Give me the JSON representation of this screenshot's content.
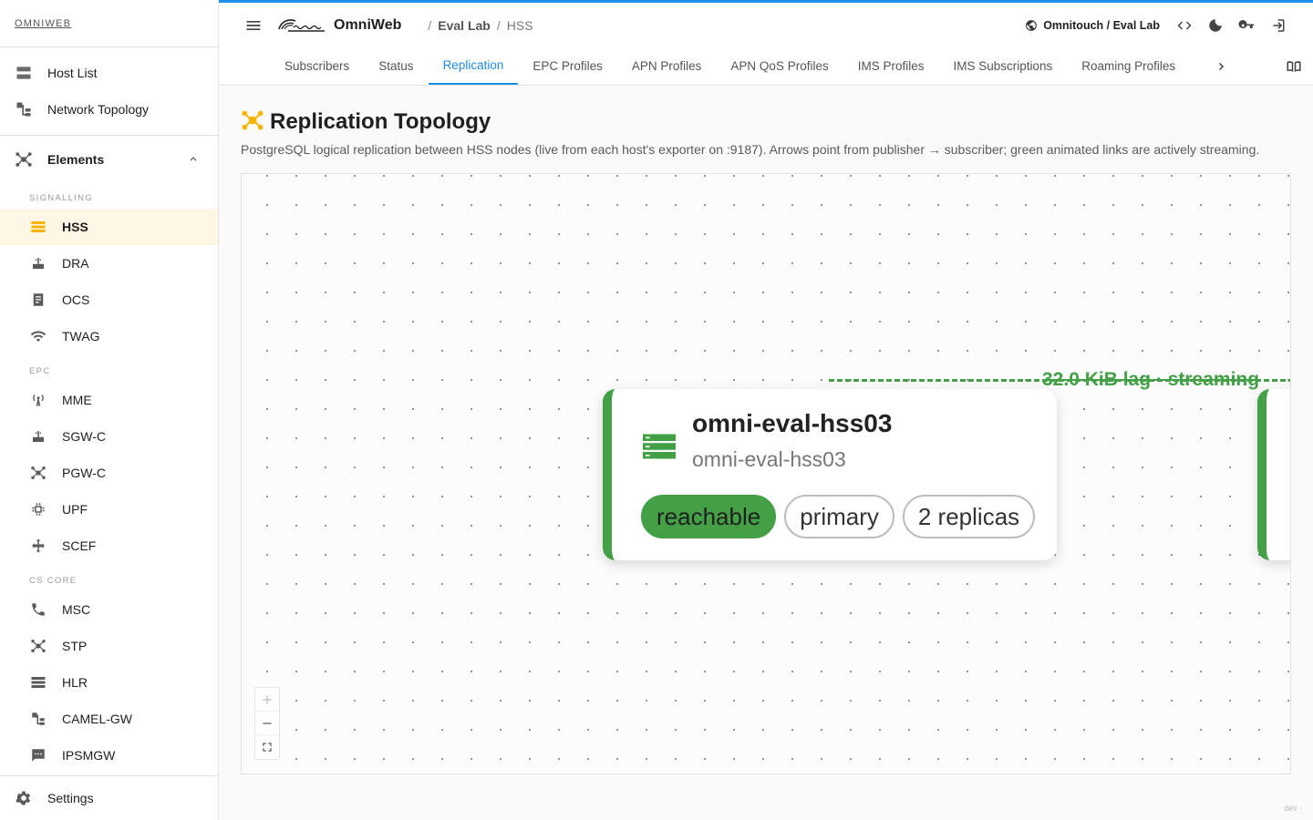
{
  "brand": "OMNIWEB",
  "nav": {
    "top_items": [
      {
        "label": "Host List",
        "icon": "host-list-icon"
      },
      {
        "label": "Network Topology",
        "icon": "network-topology-icon"
      }
    ],
    "elements_label": "Elements",
    "sections": [
      {
        "label": "SIGNALLING",
        "items": [
          {
            "label": "HSS",
            "active": true
          },
          {
            "label": "DRA"
          },
          {
            "label": "OCS"
          },
          {
            "label": "TWAG"
          }
        ]
      },
      {
        "label": "EPC",
        "items": [
          {
            "label": "MME"
          },
          {
            "label": "SGW-C"
          },
          {
            "label": "PGW-C"
          },
          {
            "label": "UPF"
          },
          {
            "label": "SCEF"
          }
        ]
      },
      {
        "label": "CS CORE",
        "items": [
          {
            "label": "MSC"
          },
          {
            "label": "STP"
          },
          {
            "label": "HLR"
          },
          {
            "label": "CAMEL-GW"
          },
          {
            "label": "IPSMGW"
          }
        ]
      }
    ],
    "settings_label": "Settings"
  },
  "topbar": {
    "app_name": "OmniWeb",
    "breadcrumb": [
      "Eval Lab",
      "HSS"
    ],
    "tenant": "Omnitouch / Eval Lab",
    "accent": "#1f8ce6"
  },
  "tabs": [
    "Subscribers",
    "Status",
    "Replication",
    "EPC Profiles",
    "APN Profiles",
    "APN QoS Profiles",
    "IMS Profiles",
    "IMS Subscriptions",
    "Roaming Profiles"
  ],
  "active_tab": "Replication",
  "page": {
    "title": "Replication Topology",
    "description": "PostgreSQL logical replication between HSS nodes (live from each host's exporter on :9187). Arrows point from publisher → subscriber; green animated links are actively streaming."
  },
  "topology": {
    "edge_label": "32.0 KiB lag · streaming",
    "edge_color": "#43a047",
    "node": {
      "name": "omni-eval-hss03",
      "host": "omni-eval-hss03",
      "chips": [
        "reachable",
        "primary",
        "2 replicas"
      ]
    }
  },
  "footer": {
    "env": "dev ·"
  }
}
